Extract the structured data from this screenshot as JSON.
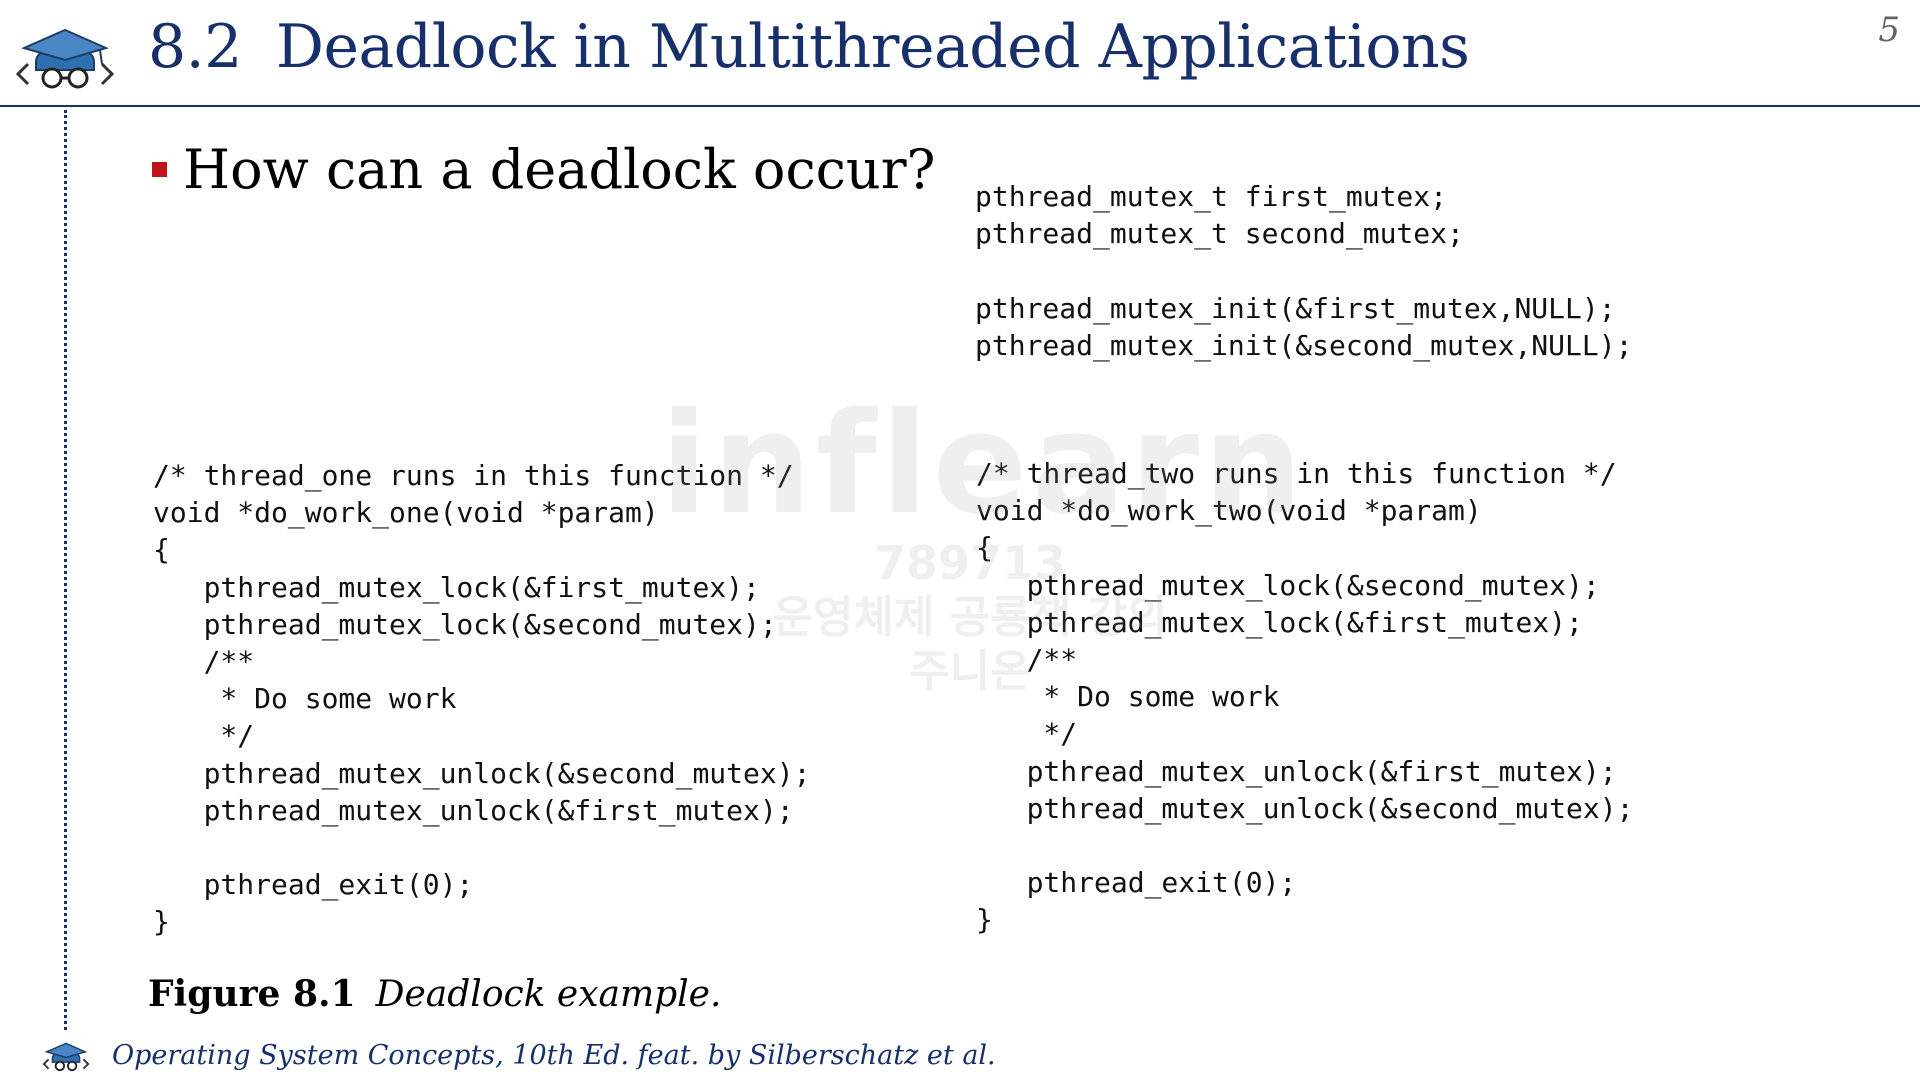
{
  "header": {
    "section_number": "8.2",
    "title": "Deadlock in Multithreaded Applications",
    "page_number": "5",
    "logo_icon": "graduate-cap-glasses-code-logo-icon"
  },
  "content": {
    "bullet_text": "How can a deadlock occur?",
    "declarations": [
      "pthread_mutex_t first_mutex;",
      "pthread_mutex_t second_mutex;",
      "",
      "pthread_mutex_init(&first_mutex,NULL);",
      "pthread_mutex_init(&second_mutex,NULL);"
    ],
    "thread_one_code": [
      "/* thread_one runs in this function */",
      "void *do_work_one(void *param)",
      "{",
      "   pthread_mutex_lock(&first_mutex);",
      "   pthread_mutex_lock(&second_mutex);",
      "   /**",
      "    * Do some work",
      "    */",
      "   pthread_mutex_unlock(&second_mutex);",
      "   pthread_mutex_unlock(&first_mutex);",
      "",
      "   pthread_exit(0);",
      "}"
    ],
    "thread_two_code": [
      "/* thread_two runs in this function */",
      "void *do_work_two(void *param)",
      "{",
      "   pthread_mutex_lock(&second_mutex);",
      "   pthread_mutex_lock(&first_mutex);",
      "   /**",
      "    * Do some work",
      "    */",
      "   pthread_mutex_unlock(&first_mutex);",
      "   pthread_mutex_unlock(&second_mutex);",
      "",
      "   pthread_exit(0);",
      "}"
    ]
  },
  "figure": {
    "label": "Figure 8.1",
    "caption": "Deadlock example."
  },
  "watermark": {
    "brand": "inflearn",
    "id": "789713",
    "line1": "운영체제 공룡책 강의",
    "line2": "주니온"
  },
  "footer": {
    "text": "Operating System Concepts, 10th Ed. feat. by Silberschatz et al.",
    "logo_icon": "graduate-cap-glasses-code-logo-icon"
  },
  "colors": {
    "title": "#17306b",
    "bullet": "#c0141b",
    "footer": "#17306b",
    "rule": "#17306b"
  }
}
